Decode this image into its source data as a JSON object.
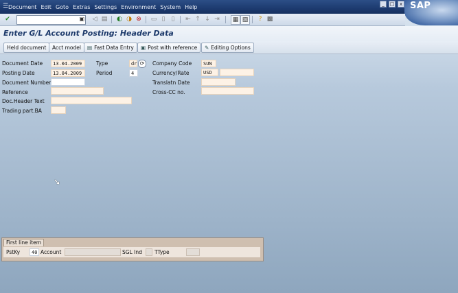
{
  "menu": {
    "items": [
      "Document",
      "Edit",
      "Goto",
      "Extras",
      "Settings",
      "Environment",
      "System",
      "Help"
    ]
  },
  "brand": {
    "logo_text": "SAP",
    "color": "#1d3b70"
  },
  "window_controls": [
    "_",
    "□",
    "x"
  ],
  "toolbar": {
    "command_field_value": "",
    "icons": [
      "enter-icon",
      "save-icon",
      "back-icon",
      "exit-icon",
      "cancel-icon",
      "print-icon",
      "find-icon",
      "find-next-icon",
      "first-page-icon",
      "prev-page-icon",
      "next-page-icon",
      "last-page-icon",
      "new-session-icon",
      "shortcut-icon",
      "help-icon",
      "customize-layout-icon"
    ]
  },
  "title": "Enter G/L Account Posting: Header Data",
  "app_toolbar": {
    "held_document": "Held document",
    "acct_model": "Acct model",
    "fast_data_entry": "Fast Data Entry",
    "post_with_reference": "Post with reference",
    "editing_options": "Editing Options"
  },
  "form": {
    "document_date": {
      "label": "Document Date",
      "value": "13.04.2009"
    },
    "posting_date": {
      "label": "Posting Date",
      "value": "13.04.2009"
    },
    "document_number": {
      "label": "Document Number",
      "value": ""
    },
    "reference": {
      "label": "Reference",
      "value": ""
    },
    "doc_header_text": {
      "label": "Doc.Header Text",
      "value": ""
    },
    "trading_part_ba": {
      "label": "Trading part.BA",
      "value": ""
    },
    "type": {
      "label": "Type",
      "value": "dr"
    },
    "period": {
      "label": "Period",
      "value": "4"
    },
    "company_code": {
      "label": "Company Code",
      "value": "SUN"
    },
    "currency_rate": {
      "label": "Currency/Rate",
      "currency": "USD",
      "rate": ""
    },
    "translatn_date": {
      "label": "Translatn Date",
      "value": ""
    },
    "cross_cc_no": {
      "label": "Cross-CC no.",
      "value": ""
    }
  },
  "first_line_item": {
    "tab_label": "First line item",
    "pstky_label": "PstKy",
    "pstky_value": "40",
    "account_label": "Account",
    "account_value": "",
    "sgl_ind_label": "SGL Ind",
    "sgl_ind_value": "",
    "ttype_label": "TType",
    "ttype_value": ""
  }
}
